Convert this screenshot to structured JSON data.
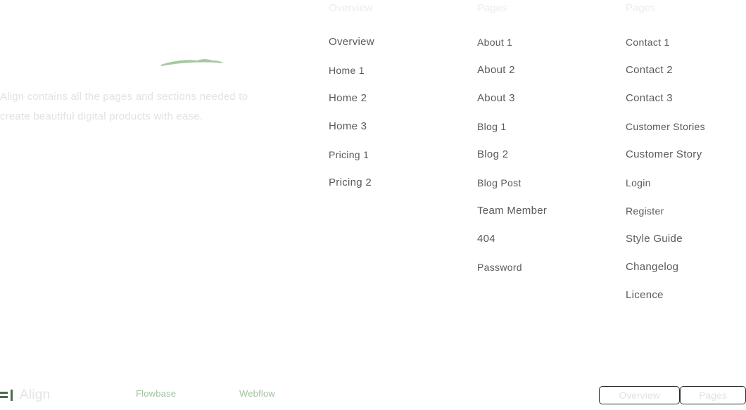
{
  "brand": {
    "logo_icon": "align-logo-icon",
    "logo_text": "Align",
    "accent_color": "#a9c7a5",
    "swoosh_icon": "brush-swoosh-icon"
  },
  "intro": {
    "tagline": "Align contains all the pages and sections needed to create beautiful digital products with ease."
  },
  "columns": [
    {
      "title": "Overview",
      "links": [
        "Overview",
        "Home 1",
        "Home 2",
        "Home 3",
        "Pricing 1",
        "Pricing 2"
      ]
    },
    {
      "title": "Pages",
      "links": [
        "About 1",
        "About 2",
        "About 3",
        "Blog 1",
        "Blog 2",
        "Blog Post",
        "Team Member",
        "404",
        "Password"
      ]
    },
    {
      "title": "Pages",
      "links": [
        "Contact 1",
        "Contact 2",
        "Contact 3",
        "Customer Stories",
        "Customer Story",
        "Login",
        "Register",
        "Style Guide",
        "Changelog",
        "Licence"
      ]
    }
  ],
  "footer": {
    "links": [
      "Flowbase",
      "Webflow"
    ],
    "buttons": [
      "Overview",
      "Pages"
    ]
  }
}
